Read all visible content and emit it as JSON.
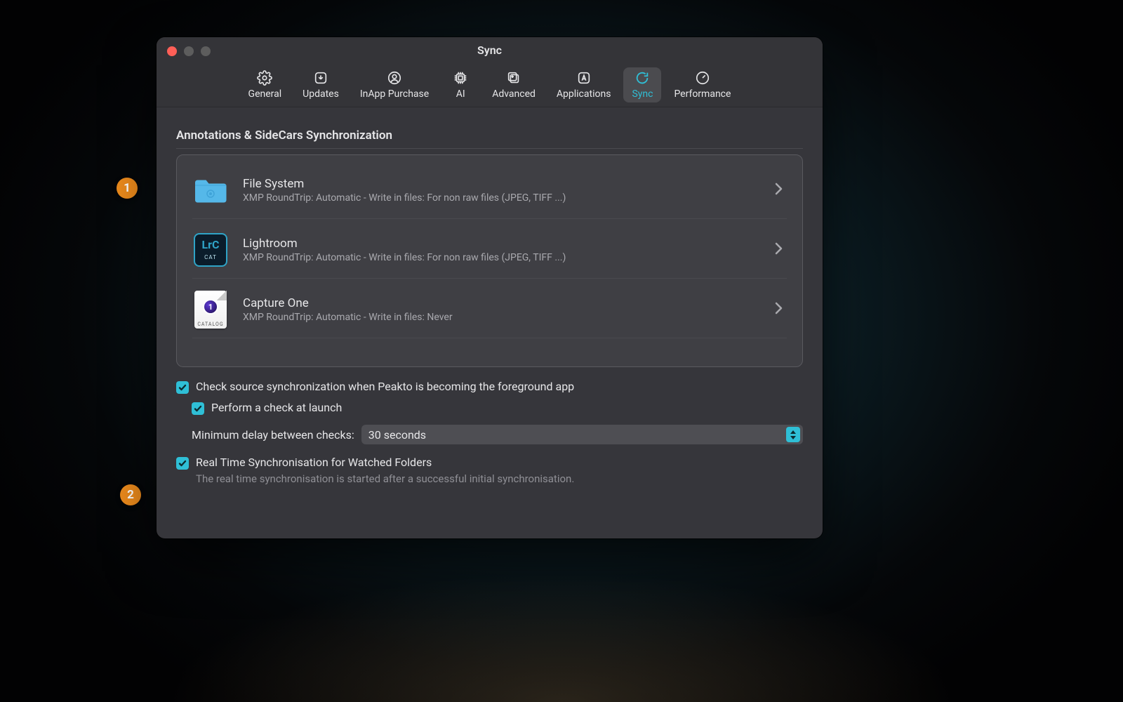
{
  "window": {
    "title": "Sync"
  },
  "toolbar": {
    "tabs": [
      {
        "label": "General"
      },
      {
        "label": "Updates"
      },
      {
        "label": "InApp Purchase"
      },
      {
        "label": "AI"
      },
      {
        "label": "Advanced"
      },
      {
        "label": "Applications"
      },
      {
        "label": "Sync"
      },
      {
        "label": "Performance"
      }
    ],
    "active_index": 6
  },
  "section": {
    "title": "Annotations & SideCars Synchronization"
  },
  "sources": [
    {
      "title": "File System",
      "subtitle": "XMP RoundTrip: Automatic - Write in files: For non raw files (JPEG, TIFF ...)"
    },
    {
      "title": "Lightroom",
      "subtitle": "XMP RoundTrip: Automatic - Write in files: For non raw files (JPEG, TIFF ...)"
    },
    {
      "title": "Capture One",
      "subtitle": "XMP RoundTrip: Automatic - Write in files: Never"
    }
  ],
  "lrc_icon": {
    "main": "LrC",
    "sub": "CAT"
  },
  "c1_icon": {
    "glyph": "1",
    "caption": "CATALOG"
  },
  "checks": {
    "foreground": "Check source synchronization when Peakto is becoming the foreground app",
    "launch": "Perform a check at launch",
    "realtime": "Real Time Synchronisation for Watched Folders",
    "realtime_help": "The real time synchronisation is started after a successful initial synchronisation."
  },
  "delay": {
    "label": "Minimum delay between checks:",
    "value": "30 seconds"
  },
  "annotations": {
    "b1": "1",
    "b2": "2"
  },
  "colors": {
    "accent": "#2fbfd6",
    "badge": "#ed8b1c"
  }
}
